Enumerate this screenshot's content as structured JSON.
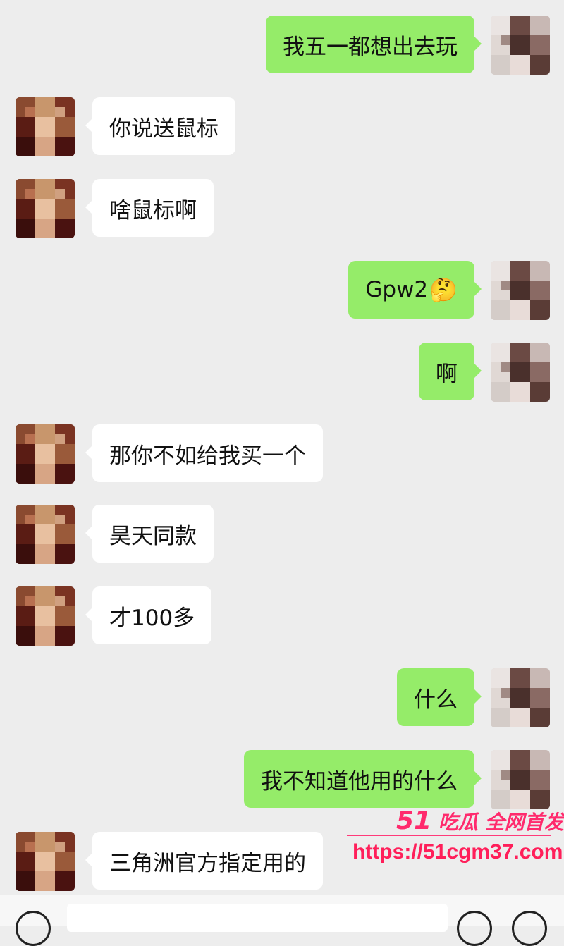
{
  "messages": [
    {
      "side": "right",
      "text": "我五一都想出去玩"
    },
    {
      "side": "left",
      "text": "你说送鼠标"
    },
    {
      "side": "left",
      "text": "啥鼠标啊"
    },
    {
      "side": "right",
      "text": "Gpw2",
      "emoji": "🤔"
    },
    {
      "side": "right",
      "text": "啊"
    },
    {
      "side": "left",
      "text": "那你不如给我买一个"
    },
    {
      "side": "left",
      "text": "昊天同款"
    },
    {
      "side": "left",
      "text": "才100多"
    },
    {
      "side": "right",
      "text": "什么"
    },
    {
      "side": "right",
      "text": "我不知道他用的什么"
    },
    {
      "side": "left",
      "text": "三角洲官方指定用的"
    }
  ],
  "watermark": {
    "number": "51",
    "title": "吃瓜 全网首发",
    "url": "https://51cgm37.com"
  },
  "icons": {
    "voice": "voice-icon",
    "emoji": "emoji-icon",
    "plus": "plus-icon"
  },
  "colors": {
    "background": "#ededed",
    "sent_bubble": "#95ec69",
    "received_bubble": "#ffffff",
    "watermark": "#ff2a6d"
  }
}
